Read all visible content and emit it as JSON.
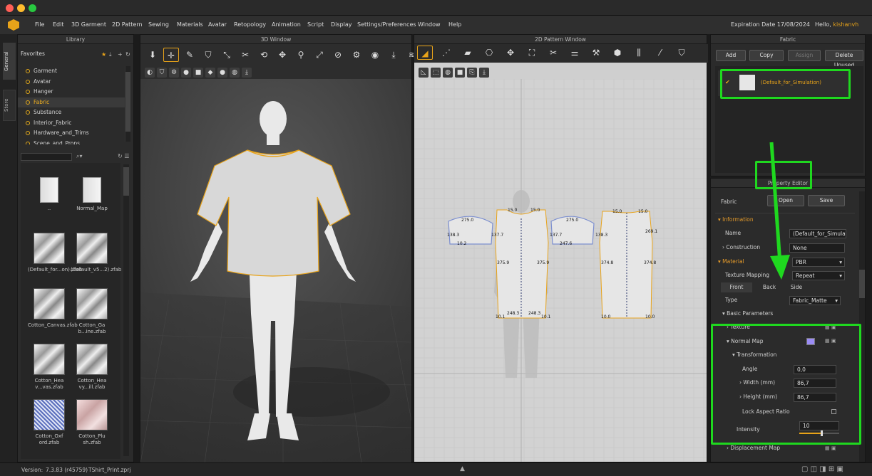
{
  "app": {
    "expiration": "Expiration Date 17/08/2024",
    "hello_prefix": "Hello, ",
    "username": "kishanvh",
    "version_label": "Version:",
    "version": "7.3.83 (r45759)",
    "file": "TShirt_Print.zprj"
  },
  "menu": [
    "File",
    "Edit",
    "3D Garment",
    "2D Pattern",
    "Sewing",
    "Materials",
    "Avatar",
    "Retopology",
    "Animation",
    "Script",
    "Display",
    "Settings/Preferences",
    "Window",
    "Help"
  ],
  "side_tabs": [
    "General",
    "Store"
  ],
  "library": {
    "title": "Library",
    "favorites": "Favorites",
    "items": [
      "Garment",
      "Avatar",
      "Hanger",
      "Fabric",
      "Substance",
      "Interior_Fabric",
      "Hardware_and_Trims",
      "Scene_and_Props"
    ],
    "selected": "Fabric",
    "files": [
      {
        "label": "..",
        "kind": "folder"
      },
      {
        "label": "Normal_Map",
        "kind": "folder"
      },
      {
        "label": "(Default_for...on).zfab",
        "kind": "fabric"
      },
      {
        "label": "(Default_v5...2).zfab",
        "kind": "fabric"
      },
      {
        "label": "Cotton_Canvas.zfab",
        "kind": "fabric"
      },
      {
        "label": "Cotton_Ga b...ine.zfab",
        "kind": "fabric"
      },
      {
        "label": "Cotton_Hea v...vas.zfab",
        "kind": "fabric"
      },
      {
        "label": "Cotton_Hea vy...ill.zfab",
        "kind": "fabric"
      },
      {
        "label": "Cotton_Oxf ord.zfab",
        "kind": "oxford"
      },
      {
        "label": "Cotton_Plu sh.zfab",
        "kind": "plush"
      }
    ]
  },
  "window3d": {
    "title": "3D Window"
  },
  "window2d": {
    "title": "2D Pattern Window",
    "labels": [
      "275.0",
      "15.0",
      "15.0",
      "275.0",
      "15.0",
      "15.0",
      "138.3",
      "137.7",
      "137.7",
      "138.3",
      "269.1",
      "375.9",
      "375.9",
      "374.8",
      "374.8",
      "248.3",
      "248.3",
      "10.1",
      "10.1",
      "10.0",
      "10.0",
      "10.2",
      "247.6"
    ]
  },
  "fabric": {
    "title": "Fabric",
    "buttons": {
      "add": "Add",
      "copy": "Copy",
      "assign": "Assign",
      "delete_unused": "Delete Unused"
    },
    "list": [
      "(Default_for_Simulation)"
    ]
  },
  "property_editor": {
    "title": "Property Editor",
    "fabric_label": "Fabric",
    "open": "Open",
    "save": "Save",
    "information": "Information",
    "name_label": "Name",
    "name_value": "(Default_for_Simulation)",
    "construction_label": "Construction",
    "construction_value": "None",
    "material": "Material",
    "material_type": "PBR",
    "texture_mapping_label": "Texture Mapping",
    "texture_mapping_value": "Repeat",
    "tabs": [
      "Front",
      "Back",
      "Side"
    ],
    "type_label": "Type",
    "type_value": "Fabric_Matte",
    "basic_parameters": "Basic Parameters",
    "texture": "Texture",
    "normal_map": "Normal Map",
    "normal_map_color": "#9b8cf5",
    "transformation": "Transformation",
    "angle_label": "Angle",
    "angle_value": "0,0",
    "width_label": "Width (mm)",
    "width_value": "86,7",
    "height_label": "Height (mm)",
    "height_value": "86,7",
    "lock_aspect": "Lock Aspect Ratio",
    "intensity_label": "Intensity",
    "intensity_value": "10",
    "intensity_level": 0.55,
    "displacement_map": "Displacement Map"
  },
  "colors": {
    "accent": "#e8a319",
    "highlight": "#1fd81f"
  }
}
